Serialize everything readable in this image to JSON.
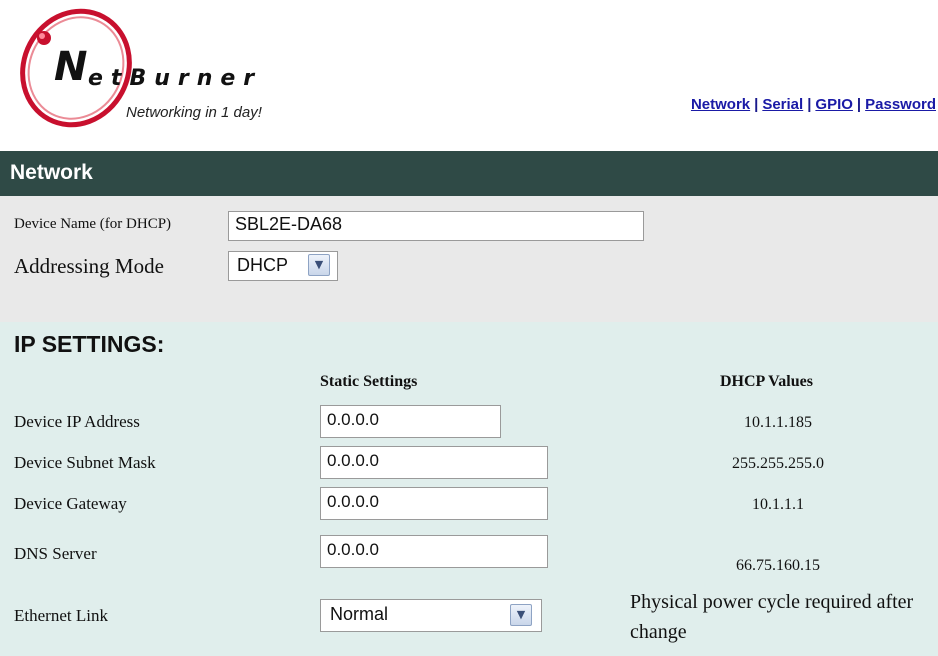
{
  "header": {
    "brand_initial": "N",
    "brand_rest": "etBurner",
    "tagline": "Networking in 1 day!",
    "nav_links": [
      "Network",
      "Serial",
      "GPIO",
      "Password"
    ],
    "nav_separator": "|"
  },
  "section": {
    "title": "Network"
  },
  "device": {
    "name_label": "Device Name (for DHCP)",
    "name_value": "SBL2E-DA68",
    "addressing_label": "Addressing Mode",
    "addressing_value": "DHCP"
  },
  "ip_settings": {
    "title": "IP SETTINGS:",
    "col_static": "Static Settings",
    "col_dhcp": "DHCP Values",
    "rows": [
      {
        "label": "Device IP Address",
        "static": "0.0.0.0",
        "dhcp": "10.1.1.185"
      },
      {
        "label": "Device Subnet Mask",
        "static": "0.0.0.0",
        "dhcp": "255.255.255.0"
      },
      {
        "label": "Device Gateway",
        "static": "0.0.0.0",
        "dhcp": "10.1.1.1"
      },
      {
        "label": "DNS Server",
        "static": "0.0.0.0",
        "dhcp": "66.75.160.15"
      }
    ],
    "ethernet_label": "Ethernet Link",
    "ethernet_value": "Normal",
    "power_note": "Physical power cycle required after change"
  },
  "colors": {
    "section_bar": "#2f4a46",
    "device_panel": "#e9e9e9",
    "ip_panel": "#e0eeec",
    "logo_red": "#c8102e",
    "link": "#1a1aa6"
  },
  "icons": {
    "dropdown": "chevron-down-icon",
    "logo": "netburner-swoosh-logo"
  }
}
